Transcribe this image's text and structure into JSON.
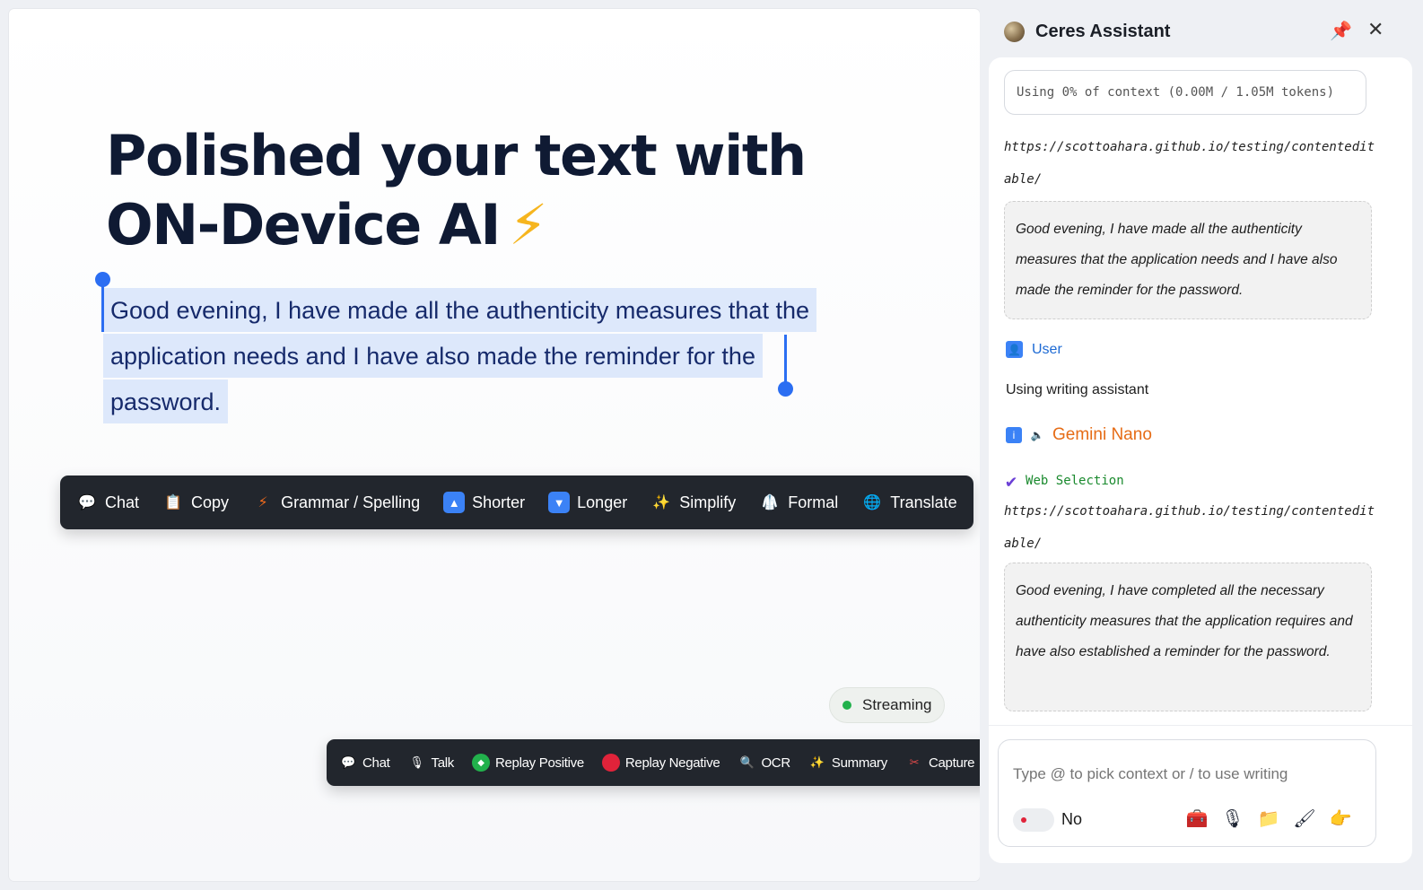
{
  "hero": {
    "line1": "Polished your text with",
    "line2": "ON-Device AI",
    "emoji": "⚡"
  },
  "selection": {
    "line1": "Good evening, I have made all the authenticity measures that the",
    "line2": "application needs and I have also made the reminder for the",
    "line3": "password."
  },
  "main_toolbar": {
    "items": [
      {
        "label": "Chat",
        "icon": "speech-bubble-icon",
        "glyph": "💬"
      },
      {
        "label": "Copy",
        "icon": "clipboard-icon",
        "glyph": "📋"
      },
      {
        "label": "Grammar / Spelling",
        "icon": "lightning-icon",
        "glyph": "⚡"
      },
      {
        "label": "Shorter",
        "icon": "up-arrow-icon",
        "glyph": "🔼"
      },
      {
        "label": "Longer",
        "icon": "down-arrow-icon",
        "glyph": "🔽"
      },
      {
        "label": "Simplify",
        "icon": "sparkles-icon",
        "glyph": "✨"
      },
      {
        "label": "Formal",
        "icon": "suit-icon",
        "glyph": "🥼"
      },
      {
        "label": "Translate",
        "icon": "globe-icon",
        "glyph": "🌐"
      }
    ]
  },
  "streaming": {
    "label": "Streaming"
  },
  "bottom_toolbar": {
    "items": [
      {
        "label": "Chat",
        "icon": "speech-bubble-icon",
        "glyph": "💬"
      },
      {
        "label": "Talk",
        "icon": "microphone-icon",
        "glyph": "🎙"
      },
      {
        "label": "Replay Positive",
        "icon": "green-circle-icon",
        "glyph": "🟢"
      },
      {
        "label": "Replay Negative",
        "icon": "red-circle-icon",
        "glyph": "🔴"
      },
      {
        "label": "OCR",
        "icon": "magnifier-icon",
        "glyph": "🔍"
      },
      {
        "label": "Summary",
        "icon": "sparkles-icon",
        "glyph": "✨"
      },
      {
        "label": "Capture",
        "icon": "scissors-icon",
        "glyph": "✂"
      }
    ],
    "add_glyph": "+"
  },
  "assistant": {
    "title": "Ceres Assistant",
    "pin_glyph": "📌",
    "close_glyph": "✕",
    "context": "Using 0% of context (0.00M / 1.05M tokens)",
    "url1": "https://scottoahara.github.io/testing/contenteditable/",
    "quote1": "Good evening, I have made all the authenticity measures that the application needs and I have also made the reminder for the password.",
    "user_label": "User",
    "user_message": "Using writing assistant",
    "model_label": "Gemini Nano",
    "web_selection": "Web Selection",
    "url2": "https://scottoahara.github.io/testing/contenteditable/",
    "quote2": "Good evening, I have completed all the necessary authenticity measures that the application requires and have also established a reminder for the password.",
    "composer_placeholder": "Type @ to pick context or / to use writing",
    "toggle_label": "No",
    "composer_icons": [
      {
        "icon": "toolbox-icon",
        "glyph": "🧰"
      },
      {
        "icon": "microphone-icon",
        "glyph": "🎙"
      },
      {
        "icon": "folder-icon",
        "glyph": "📁"
      },
      {
        "icon": "brush-icon",
        "glyph": "🖌"
      },
      {
        "icon": "pointing-hand-icon",
        "glyph": "👉"
      }
    ]
  }
}
